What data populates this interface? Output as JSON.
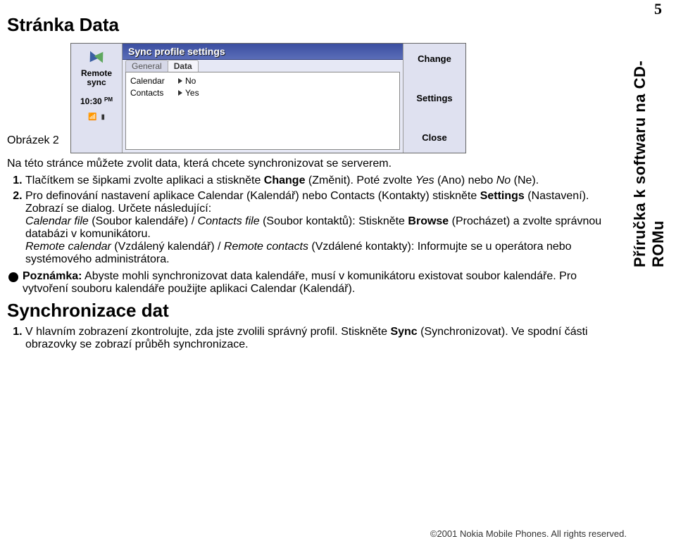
{
  "page_number": "5",
  "side_label": "Příručka k softwaru na CD-ROMu",
  "title": "Stránka Data",
  "figure_label": "Obrázek 2",
  "device": {
    "left_label_line1": "Remote",
    "left_label_line2": "sync",
    "time": "10:30",
    "time_suffix": "PM",
    "title_bar": "Sync profile settings",
    "tab_general": "General",
    "tab_data": "Data",
    "row_calendar_label": "Calendar",
    "row_calendar_value": "No",
    "row_contacts_label": "Contacts",
    "row_contacts_value": "Yes",
    "btn_change": "Change",
    "btn_settings": "Settings",
    "btn_close": "Close"
  },
  "lead": "Na této stránce můžete zvolit data, která chcete synchronizovat se serverem.",
  "step1": {
    "num": "1",
    "part_a": "Tlačítkem se šipkami zvolte aplikaci a stiskněte ",
    "change": "Change",
    "part_b": " (Změnit). Poté zvolte ",
    "yes_i": "Yes",
    "part_c": " (Ano) nebo ",
    "no_i": "No",
    "part_d": " (Ne)."
  },
  "step2": {
    "num": "2",
    "part_a": "Pro definování nastavení aplikace Calendar (Kalendář) nebo Contacts (Kontakty) stiskněte ",
    "settings": "Settings",
    "part_b": " (Nastavení). Zobrazí se dialog. Určete následující:",
    "cal_file": "Calendar file",
    "part_c": " (Soubor kalendáře) / ",
    "con_file": "Contacts file",
    "part_d": " (Soubor kontaktů): Stiskněte ",
    "browse": "Browse",
    "part_e": " (Procházet) a zvolte správnou databázi v komunikátoru.",
    "rem_cal": "Remote calendar",
    "part_f": " (Vzdálený kalendář) / ",
    "rem_con": "Remote contacts",
    "part_g": " (Vzdálené kontakty): Informujte se u operátora nebo systémového administrátora."
  },
  "note": {
    "label": "Poznámka:",
    "body": " Abyste mohli synchronizovat data kalendáře, musí v komunikátoru existovat soubor kalendáře. Pro vytvoření souboru kalendáře použijte aplikaci Calendar (Kalendář)."
  },
  "sync_heading": "Synchronizace dat",
  "sync_step1": {
    "num": "1",
    "part_a": "V hlavním zobrazení zkontrolujte, zda jste zvolili správný profil. Stiskněte ",
    "sync": "Sync",
    "part_b": " (Synchronizovat). Ve spodní části obrazovky se zobrazí průběh synchronizace."
  },
  "footer_copyright": "2001 Nokia Mobile Phones. All rights reserved."
}
